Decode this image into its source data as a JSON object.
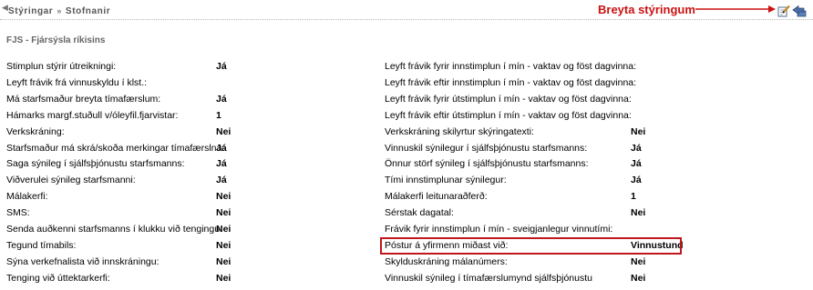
{
  "header": {
    "breadcrumb": [
      "Stýringar",
      "Stofnanir"
    ],
    "breadcrumb_sep": "»",
    "annotation_label": "Breyta stýringum",
    "back_icon": "left-triangle-icon",
    "tool_icons": [
      "edit-icon",
      "back-arrow-icon"
    ],
    "accent": "#cc1111"
  },
  "subtitle": "FJS - Fjársýsla ríkisins",
  "left_col": [
    {
      "label": "Stimplun stýrir útreikningi:",
      "value": "Já"
    },
    {
      "label": "Leyft frávik frá vinnuskyldu í klst.:",
      "value": ""
    },
    {
      "label": "Má starfsmaður breyta tímafærslum:",
      "value": "Já"
    },
    {
      "label": "Hámarks margf.stuðull v/óleyfil.fjarvistar:",
      "value": "1"
    },
    {
      "label": "Verkskráning:",
      "value": "Nei"
    },
    {
      "label": "Starfsmaður má skrá/skoða merkingar tímafærslna:",
      "value": "Já"
    },
    {
      "label": "Saga sýnileg í sjálfsþjónustu starfsmanns:",
      "value": "Já"
    },
    {
      "label": "Viðverulei sýnileg starfsmanni:",
      "value": "Já"
    },
    {
      "label": "Málakerfi:",
      "value": "Nei"
    },
    {
      "label": "SMS:",
      "value": "Nei"
    },
    {
      "label": "Senda auðkenni starfsmanns í klukku við tengingu:",
      "value": "Nei"
    },
    {
      "label": "Tegund tímabils:",
      "value": "Nei"
    },
    {
      "label": "Sýna verkefnalista við innskráningu:",
      "value": "Nei"
    },
    {
      "label": "Tenging við úttektarkerfi:",
      "value": "Nei"
    }
  ],
  "right_col": [
    {
      "label": "Leyft frávik fyrir innstimplun í mín - vaktav og föst dagvinna:",
      "value": ""
    },
    {
      "label": "Leyft frávik eftir innstimplun í mín - vaktav og föst dagvinna:",
      "value": ""
    },
    {
      "label": "Leyft frávik fyrir útstimplun í mín - vaktav og föst dagvinna:",
      "value": ""
    },
    {
      "label": "Leyft frávik eftir útstimplun í mín - vaktav og föst dagvinna:",
      "value": ""
    },
    {
      "label": "Verkskráning skilyrtur skýringatexti:",
      "value": "Nei"
    },
    {
      "label": "Vinnuskil sýnilegur í sjálfsþjónustu starfsmanns:",
      "value": "Já"
    },
    {
      "label": "Önnur störf sýnileg í sjálfsþjónustu starfsmanns:",
      "value": "Já"
    },
    {
      "label": "Tími innstimplunar sýnilegur:",
      "value": "Já"
    },
    {
      "label": "Málakerfi leitunaraðferð:",
      "value": "1"
    },
    {
      "label": "Sérstak dagatal:",
      "value": "Nei"
    },
    {
      "label": "Frávik fyrir innstimplun í mín - sveigjanlegur vinnutími:",
      "value": ""
    },
    {
      "label": "Póstur á yfirmenn miðast við:",
      "value": "Vinnustund"
    },
    {
      "label": "Skylduskráning málanúmers:",
      "value": "Nei"
    },
    {
      "label": "Vinnuskil sýnileg í tímafærslumynd sjálfsþjónustu",
      "value": "Nei"
    }
  ],
  "highlight_color": "#c0171d"
}
